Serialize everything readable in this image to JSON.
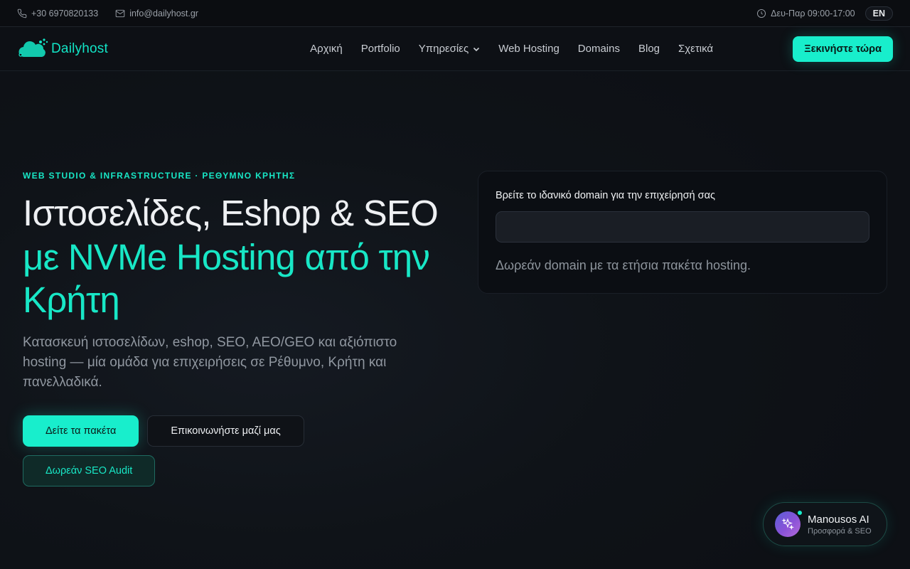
{
  "topbar": {
    "phone": "+30 6970820133",
    "email": "info@dailyhost.gr",
    "hours": "Δευ-Παρ 09:00-17:00",
    "lang": "EN"
  },
  "nav": {
    "brand": "Dailyhost",
    "links": [
      "Αρχική",
      "Portfolio",
      "Υπηρεσίες",
      "Web Hosting",
      "Domains",
      "Blog",
      "Σχετικά"
    ],
    "cta": "Ξεκινήστε τώρα"
  },
  "hero": {
    "eyebrow": "WEB STUDIO & INFRASTRUCTURE · ΡΕΘΥΜΝΟ ΚΡΗΤΗΣ",
    "title_line1": "Ιστοσελίδες, Eshop & SEO",
    "title_accent": "με NVMe Hosting από την Κρήτη",
    "lead": "Κατασκευή ιστοσελίδων, eshop, SEO, AEO/GEO και αξιόπιστο hosting — μία ομάδα για επιχειρήσεις σε Ρέθυμνο, Κρήτη και πανελλαδικά.",
    "btn_packages": "Δείτε τα πακέτα",
    "btn_contact": "Επικοινωνήστε μαζί μας",
    "btn_seo": "Δωρεάν SEO Audit"
  },
  "domain": {
    "title": "Βρείτε το ιδανικό domain για την επιχείρησή σας",
    "input_value": "",
    "note": "Δωρεάν domain με τα ετήσια πακέτα hosting."
  },
  "ai": {
    "name": "Manousos AI",
    "subtitle": "Προσφορά & SEO"
  },
  "colors": {
    "accent": "#18eecc",
    "background": "#0d1015"
  }
}
